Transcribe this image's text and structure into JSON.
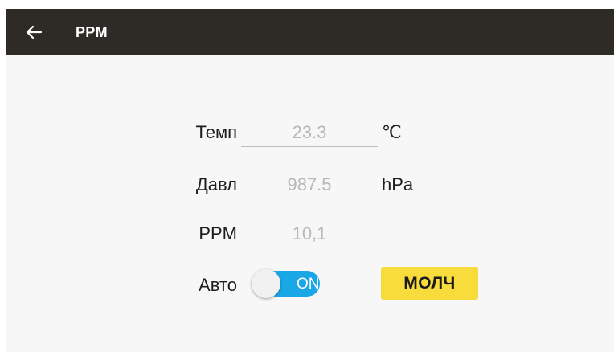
{
  "header": {
    "title": "PPM"
  },
  "form": {
    "temp": {
      "label": "Темп",
      "value": "23.3",
      "unit": "℃"
    },
    "pressure": {
      "label": "Давл",
      "value": "987.5",
      "unit": "hPa"
    },
    "ppm": {
      "label": "PPM",
      "value": "10,1"
    },
    "auto": {
      "label": "Авто",
      "toggle_text": "ON",
      "enabled": true
    },
    "mute_button_label": "МОЛЧ"
  },
  "icons": {
    "back": "arrow-left-icon"
  },
  "colors": {
    "topbar": "#2e2b27",
    "background": "#f7f7f7",
    "toggle_on": "#1aa7e6",
    "mute_button": "#f8dc3c"
  }
}
